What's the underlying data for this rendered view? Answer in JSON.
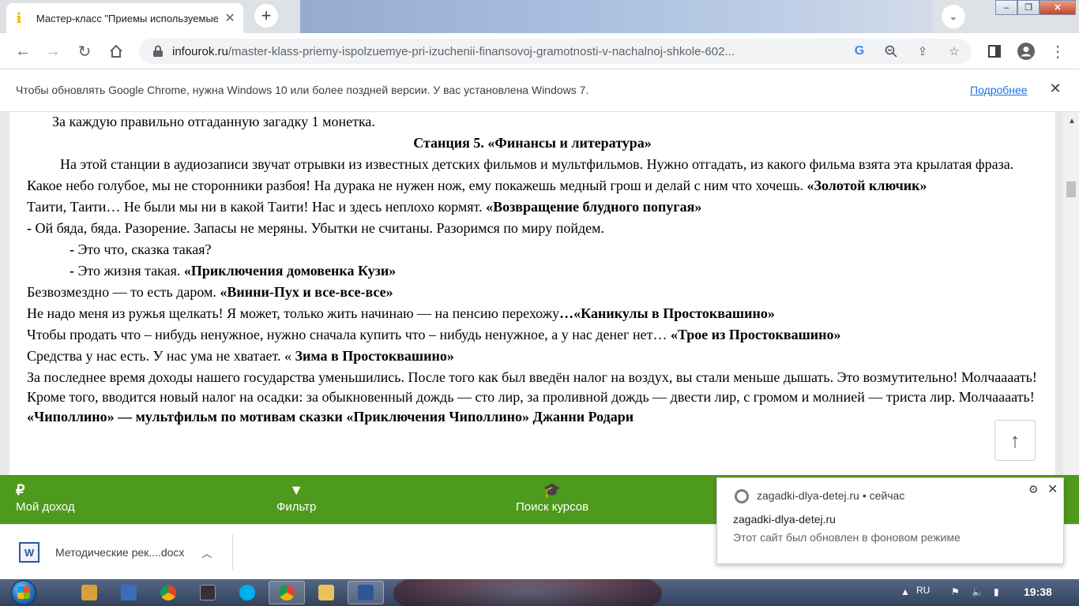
{
  "browser": {
    "tab": {
      "title": "Мастер-класс \"Приемы используемые",
      "close_glyph": "✕"
    },
    "url_host": "infourok.ru",
    "url_path": "/master-klass-priemy-ispolzuemye-pri-izuchenii-finansovoj-gramotnosti-v-nachalnoj-shkole-602..."
  },
  "infobar": {
    "message": "Чтобы обновлять Google Chrome, нужна Windows 10 или более поздней версии. У вас установлена Windows 7.",
    "link": "Подробнее"
  },
  "doc": {
    "line1": "За каждую правильно отгаданную загадку 1 монетка.",
    "station_title": "Станция 5. «Финансы и литература»",
    "intro": "На этой станции в аудиозаписи звучат отрывки из известных детских фильмов и мультфильмов. Нужно отгадать, из какого фильма взята эта крылатая фраза.",
    "q1_text": "Какое небо голубое, мы не сторонники разбоя! На дурака не нужен нож, ему покажешь медный грош и делай с ним что хочешь.",
    "q1_answer": "«Золотой ключик»",
    "q2_text": "Таити, Таити… Не были мы ни в какой Таити! Нас и здесь неплохо кормят.",
    "q2_answer": "«Возвращение блудного попугая»",
    "q3_dash": "- ",
    "q3_line1": "Ой бяда, бяда. Разорение. Запасы не меряны. Убытки не считаны. Разоримся по миру пойдем.",
    "q3_line2_dash": "- ",
    "q3_line2": "Это что, сказка такая?",
    "q3_line3_dash": "- ",
    "q3_line3": "Это жизня такая.",
    "q3_answer": "«Приключения домовенка Кузи»",
    "q4_text": "Безвозмездно — то есть даром.",
    "q4_answer": "«Винни-Пух и все-все-все»",
    "q5_text": "Не надо меня из ружья щелкать! Я может, только жить начинаю — на пенсию перехожу",
    "q5_answer": "…«Каникулы в Простоквашино»",
    "q6_text": "Чтобы продать что – нибудь ненужное, нужно сначала купить что – нибудь ненужное, а у нас денег нет…",
    "q6_answer": "«Трое из Простоквашино»",
    "q7_text": "Средства у нас есть. У нас ума не хватает. «",
    "q7_answer": " Зима в Простоквашино»",
    "q8_text": "За последнее время доходы нашего государства уменьшились. После того как был введён налог на воздух, вы стали меньше дышать. Это возмутительно! Молчаааать! Кроме того, вводится новый налог на осадки: за обыкновенный дождь — сто лир, за проливной дождь — двести лир, с громом и молнией — триста лир. Молчаааать!",
    "q8_answer": "«Чиполлино» — мультфильм по мотивам сказки «Приключения Чиполлино» Джанни Родари"
  },
  "greenbar": {
    "items": [
      {
        "icon": "₽",
        "label": "Мой доход"
      },
      {
        "icon": "▼",
        "label": "Фильтр"
      },
      {
        "icon": "🎓",
        "label": "Поиск курсов"
      }
    ]
  },
  "download": {
    "filename": "Методические рек....docx",
    "icon_letter": "W"
  },
  "notification": {
    "origin": "zagadki-dlya-detej.ru",
    "time": "сейчас",
    "title": "zagadki-dlya-detej.ru",
    "body": "Этот сайт был обновлен в фоновом режиме"
  },
  "taskbar": {
    "lang": "RU",
    "clock": "19:38",
    "apps": [
      {
        "name": "media-player",
        "color": "#d9a03a"
      },
      {
        "name": "remote-desktop",
        "color": "#3a6fb8"
      },
      {
        "name": "chrome",
        "color": "#db4437"
      },
      {
        "name": "terminal",
        "color": "#333333"
      },
      {
        "name": "skype",
        "color": "#00aff0"
      },
      {
        "name": "chrome-active",
        "color": "#db4437"
      },
      {
        "name": "explorer",
        "color": "#e8c25a"
      },
      {
        "name": "word",
        "color": "#2b5797"
      }
    ]
  },
  "colors": {
    "accent_green": "#4e9a1c",
    "link_blue": "#1a73e8"
  }
}
